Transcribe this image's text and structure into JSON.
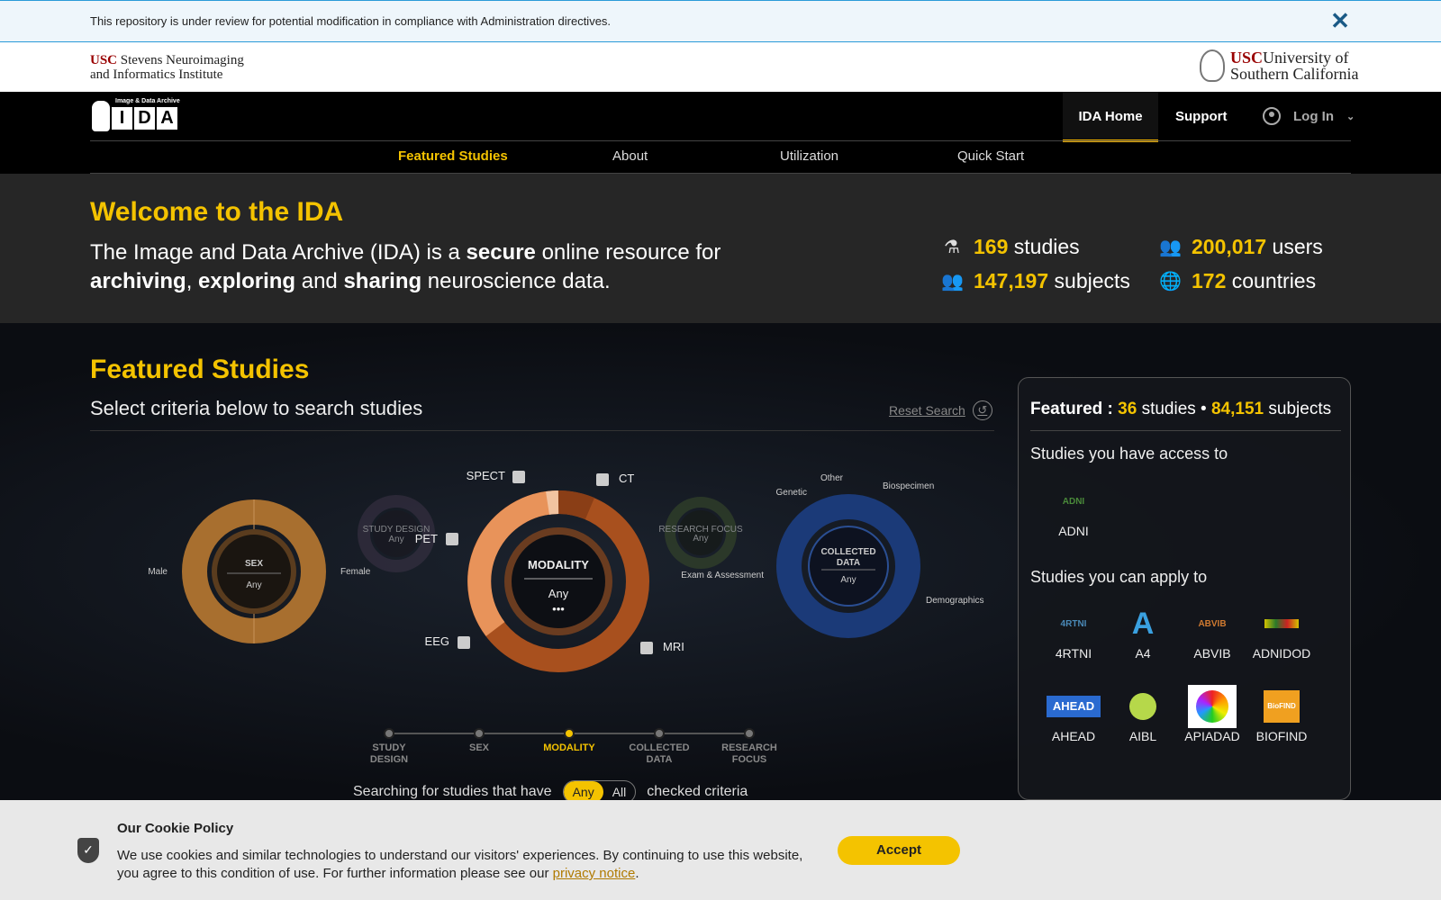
{
  "notice": {
    "text": "This repository is under review for potential modification in compliance with Administration directives.",
    "close_icon": "close-icon"
  },
  "logos": {
    "left_line1_usc": "USC",
    "left_line1_rest": "Stevens Neuroimaging",
    "left_line2": "and Informatics Institute",
    "right_usc": "USC",
    "right_line1": "University of",
    "right_line2": "Southern California"
  },
  "nav": {
    "logo_caption": "Image & Data Archive",
    "logo_letters": [
      "I",
      "D",
      "A"
    ],
    "top": [
      {
        "label": "IDA Home"
      },
      {
        "label": "Support"
      }
    ],
    "login_label": "Log In",
    "sub": [
      {
        "label": "Featured Studies"
      },
      {
        "label": "About"
      },
      {
        "label": "Utilization"
      },
      {
        "label": "Quick Start"
      }
    ]
  },
  "welcome": {
    "title": "Welcome to the IDA",
    "lead_parts": {
      "a": "The Image and Data Archive (IDA) is a ",
      "b": "secure",
      "c": " online resource for",
      "d": "archiving",
      "e": ", ",
      "f": "exploring",
      "g": " and ",
      "h": "sharing",
      "i": " neuroscience data."
    },
    "stats": [
      {
        "num": "169",
        "label": "studies",
        "icon": "microscope-icon"
      },
      {
        "num": "200,017",
        "label": "users",
        "icon": "users-icon"
      },
      {
        "num": "147,197",
        "label": "subjects",
        "icon": "subjects-icon"
      },
      {
        "num": "172",
        "label": "countries",
        "icon": "globe-icon"
      }
    ]
  },
  "featured": {
    "title": "Featured Studies",
    "subtitle": "Select criteria below to search studies",
    "reset_label": "Reset Search",
    "charts": {
      "sex": {
        "center": "SEX",
        "value": "Any",
        "labels": [
          "Male",
          "Female"
        ]
      },
      "study_design": {
        "center": "STUDY DESIGN",
        "value": "Any"
      },
      "modality": {
        "center": "MODALITY",
        "value": "Any",
        "dots": "•••",
        "labels": [
          "SPECT",
          "CT",
          "PET",
          "EEG",
          "MRI"
        ]
      },
      "research_focus": {
        "center": "RESEARCH FOCUS",
        "value": "Any"
      },
      "collected_data": {
        "center_l1": "COLLECTED",
        "center_l2": "DATA",
        "value": "Any",
        "labels": [
          "Other",
          "Biospecimen",
          "Genetic",
          "Exam & Assessment",
          "Demographics"
        ]
      }
    },
    "steps": [
      {
        "l1": "STUDY",
        "l2": "DESIGN"
      },
      {
        "l1": "SEX",
        "l2": ""
      },
      {
        "l1": "MODALITY",
        "l2": ""
      },
      {
        "l1": "COLLECTED",
        "l2": "DATA"
      },
      {
        "l1": "RESEARCH",
        "l2": "FOCUS"
      }
    ],
    "searching_pre": "Searching for studies that have",
    "toggle_any": "Any",
    "toggle_all": "All",
    "searching_post": "checked criteria"
  },
  "panel": {
    "head_pre": "Featured :",
    "head_studies_num": "36",
    "head_studies": "studies •",
    "head_subjects_num": "84,151",
    "head_subjects": "subjects",
    "access_title": "Studies you have access to",
    "access": [
      {
        "name": "ADNI",
        "logo": "ADNI"
      }
    ],
    "apply_title": "Studies you can apply to",
    "apply": [
      {
        "name": "4RTNI",
        "logo": "4RTNI"
      },
      {
        "name": "A4",
        "logo": "A"
      },
      {
        "name": "ABVIB",
        "logo": "ABVIB"
      },
      {
        "name": "ADNIDOD",
        "logo": ""
      },
      {
        "name": "AHEAD",
        "logo": "AHEAD"
      },
      {
        "name": "AIBL",
        "logo": ""
      },
      {
        "name": "APIADAD",
        "logo": ""
      },
      {
        "name": "BIOFIND",
        "logo": "BioFIND"
      }
    ]
  },
  "cookie": {
    "title": "Our Cookie Policy",
    "body": "We use cookies and similar technologies to understand our visitors' experiences. By continuing to use this website, you agree to this condition of use. For further information please see our ",
    "link": "privacy notice",
    "period": ".",
    "accept": "Accept"
  }
}
